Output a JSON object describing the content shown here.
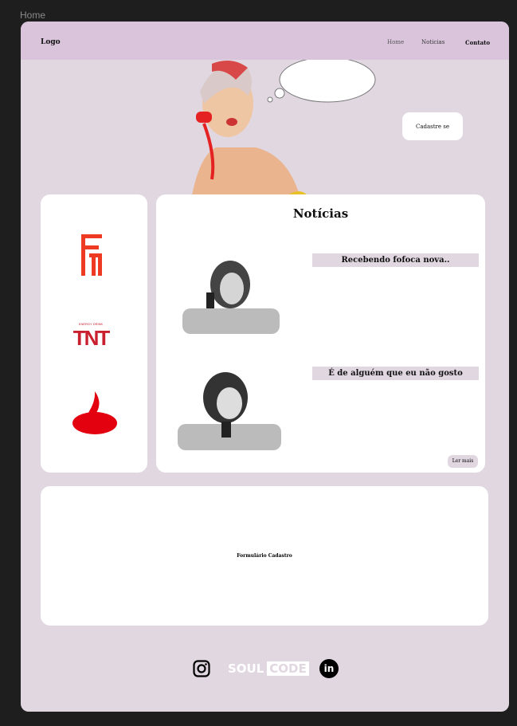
{
  "frame_label": "Home",
  "nav": {
    "logo": "Logo",
    "items": [
      "Home",
      "Noticias",
      "Contato"
    ]
  },
  "hero": {
    "cta": "Cadastre se"
  },
  "sponsors": [
    "FM",
    "TNT",
    "Santander"
  ],
  "sponsors_sub": "ENERGY DRINK",
  "news": {
    "title": "Notícias",
    "items": [
      "Recebendo fofoca nova..",
      "É de alguém que eu não gosto"
    ],
    "more": "Ler mais"
  },
  "form": {
    "label": "Formulário Cadastro"
  },
  "footer": {
    "brand_a": "SOUL",
    "brand_b": "CODE",
    "linkedin": "in"
  }
}
